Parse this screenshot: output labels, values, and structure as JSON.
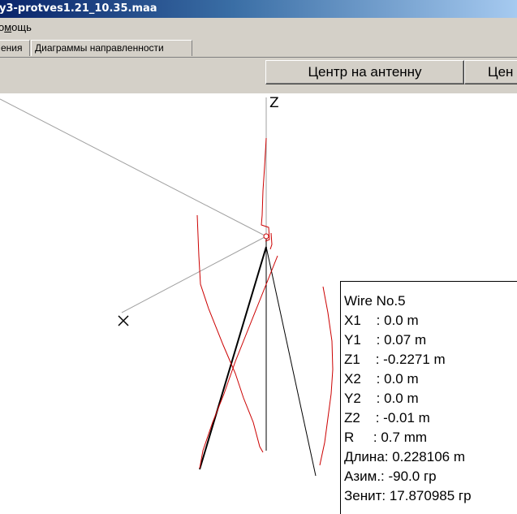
{
  "window": {
    "title": "y3-protves1.21_10.35.maa"
  },
  "menu": {
    "items": [
      "омощь"
    ],
    "partial_prefix": "о"
  },
  "tabs": [
    {
      "label": "ения"
    },
    {
      "label": "Диаграммы направленности"
    }
  ],
  "toolbar": {
    "center_on_antenna_label": "Центр на антенну",
    "next_button_label": "Цен"
  },
  "view3d": {
    "axis_z_label": "Z",
    "axis_x_label": "X",
    "colors": {
      "wire": "#000000",
      "current": "#cc0000",
      "axis": "#a0a0a0"
    }
  },
  "wire_info": {
    "title": "Wire No.5",
    "rows": [
      "X1    : 0.0 m",
      "Y1    : 0.07 m",
      "Z1    : -0.2271 m",
      "X2    : 0.0 m",
      "Y2    : 0.0 m",
      "Z2    : -0.01 m",
      "R     : 0.7 mm",
      "Длина: 0.228106 m",
      "Азим.: -90.0 гр",
      "Зенит: 17.870985 гр"
    ]
  }
}
